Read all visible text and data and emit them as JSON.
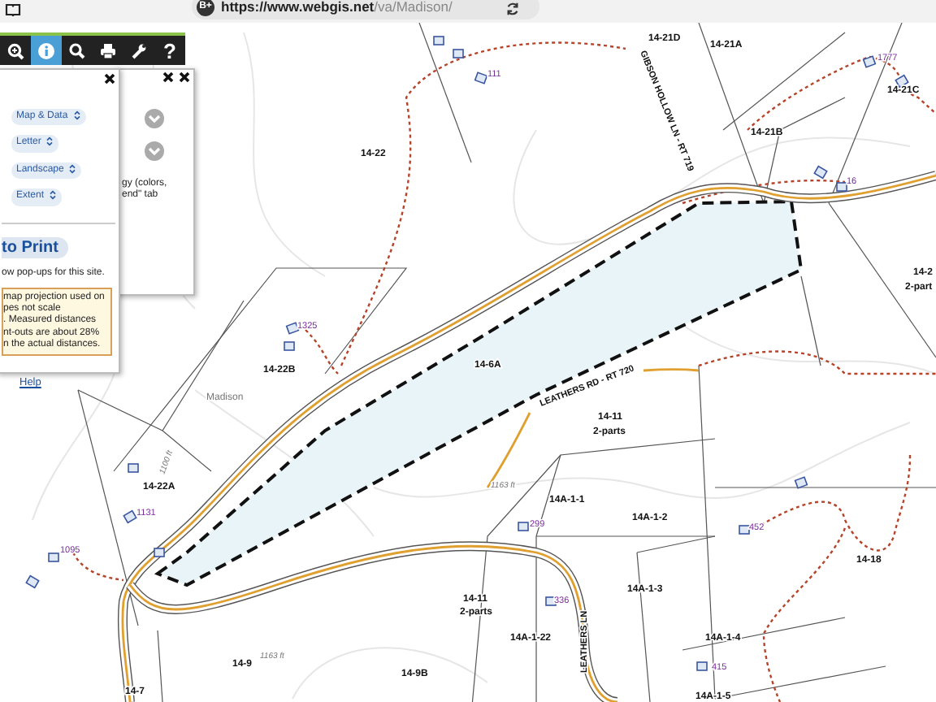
{
  "browser": {
    "badge": "B+",
    "url_host": "https://www.webgis.net",
    "url_path": "/va/Madison/"
  },
  "toolbar": [
    {
      "kind": "zoom-in",
      "selected": false
    },
    {
      "kind": "info",
      "selected": true
    },
    {
      "kind": "search",
      "selected": false
    },
    {
      "kind": "print",
      "selected": false
    },
    {
      "kind": "tools",
      "selected": false
    },
    {
      "kind": "help",
      "selected": false,
      "glyph": "?"
    }
  ],
  "back_panel": {
    "text_lines": [
      "gy (colors,",
      "end\" tab"
    ]
  },
  "print_panel": {
    "dropdowns": [
      "Map & Data",
      "Letter",
      "Landscape",
      "Extent"
    ],
    "print_button": "to Print",
    "note": "ow pop-ups for this site.",
    "warning_lines": [
      "map projection used on",
      "pes not scale",
      ". Measured distances",
      "nt-outs are about 28%",
      "n the actual distances."
    ],
    "help_link": "Help"
  },
  "map": {
    "labels": [
      {
        "kind": "parcel",
        "text": "14-21D"
      },
      {
        "kind": "parcel",
        "text": "14-21A"
      },
      {
        "kind": "parcel",
        "text": "14-21C"
      },
      {
        "kind": "parcel",
        "text": "14-21B"
      },
      {
        "kind": "parcel",
        "text": "14-22"
      },
      {
        "kind": "address",
        "text": "111"
      },
      {
        "kind": "address",
        "text": "1777"
      },
      {
        "kind": "address",
        "text": "16"
      },
      {
        "kind": "parcel",
        "text": "14-2"
      },
      {
        "kind": "parcel",
        "text": "2-part"
      },
      {
        "kind": "address",
        "text": "1325"
      },
      {
        "kind": "parcel",
        "text": "14-22B"
      },
      {
        "kind": "place",
        "text": "Madison"
      },
      {
        "kind": "parcel",
        "text": "14-6A"
      },
      {
        "kind": "road",
        "text": "LEATHERS RD - RT 720"
      },
      {
        "kind": "road",
        "text": "GIBSON HOLLOW LN - RT 719"
      },
      {
        "kind": "parcel",
        "text": "14-22A"
      },
      {
        "kind": "address",
        "text": "1131"
      },
      {
        "kind": "address",
        "text": "1095"
      },
      {
        "kind": "parcel",
        "text": "14-11"
      },
      {
        "kind": "parcel",
        "text": "2-parts"
      },
      {
        "kind": "elevation",
        "text": "1163 ft"
      },
      {
        "kind": "parcel",
        "text": "14A-1-1"
      },
      {
        "kind": "parcel",
        "text": "14A-1-2"
      },
      {
        "kind": "address",
        "text": "299"
      },
      {
        "kind": "address",
        "text": "452"
      },
      {
        "kind": "parcel",
        "text": "14-18"
      },
      {
        "kind": "parcel",
        "text": "14A-1-3"
      },
      {
        "kind": "address",
        "text": "336"
      },
      {
        "kind": "parcel",
        "text": "14-11"
      },
      {
        "kind": "parcel",
        "text": "2-parts"
      },
      {
        "kind": "parcel",
        "text": "14A-1-22"
      },
      {
        "kind": "road",
        "text": "LEATHERS LN"
      },
      {
        "kind": "parcel",
        "text": "14A-1-4"
      },
      {
        "kind": "address",
        "text": "415"
      },
      {
        "kind": "parcel",
        "text": "14A-1-5"
      },
      {
        "kind": "parcel",
        "text": "14-9"
      },
      {
        "kind": "elevation",
        "text": "1163 ft"
      },
      {
        "kind": "parcel",
        "text": "14-9B"
      },
      {
        "kind": "parcel",
        "text": "14-7"
      },
      {
        "kind": "elevation",
        "text": "1100 ft"
      }
    ]
  }
}
